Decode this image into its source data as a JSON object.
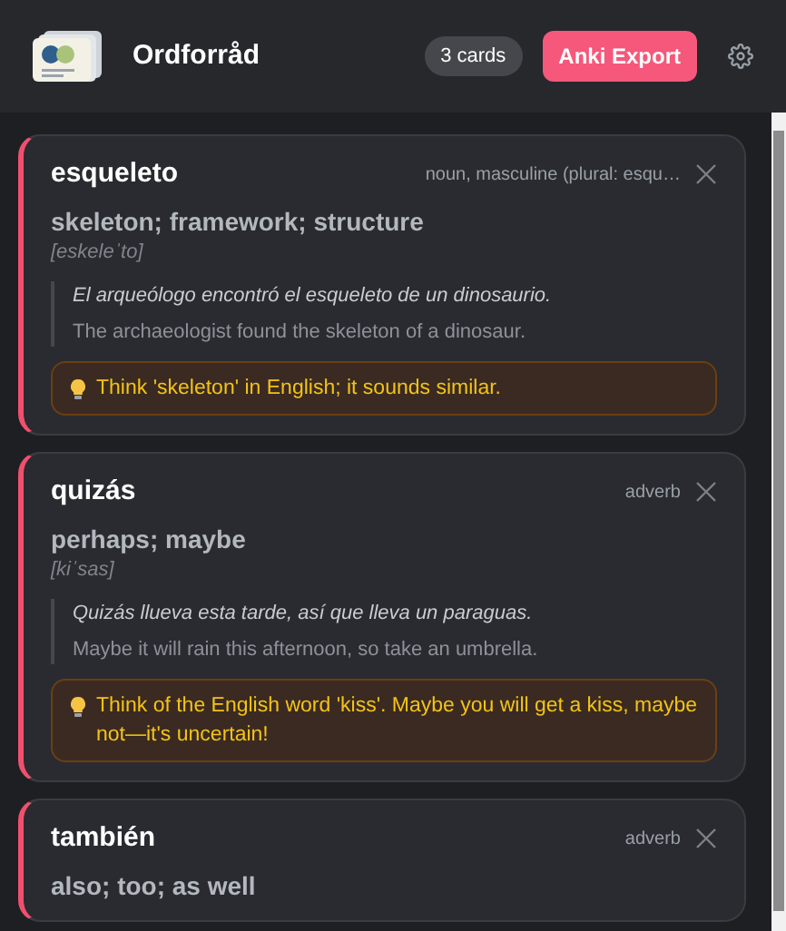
{
  "header": {
    "title": "Ordforråd",
    "count_badge": "3 cards",
    "export_button": "Anki Export"
  },
  "cards": [
    {
      "word": "esqueleto",
      "part_of_speech": "noun, masculine (plural: esqu…",
      "translation": "skeleton; framework; structure",
      "pronunciation": "[eskeleˈto]",
      "example": "El arqueólogo encontró el esqueleto de un dinosaurio.",
      "example_translation": "The archaeologist found the skeleton of a dinosaur.",
      "tip": "Think 'skeleton' in English; it sounds similar."
    },
    {
      "word": "quizás",
      "part_of_speech": "adverb",
      "translation": "perhaps; maybe",
      "pronunciation": "[kiˈsas]",
      "example": "Quizás llueva esta tarde, así que lleva un paraguas.",
      "example_translation": "Maybe it will rain this afternoon, so take an umbrella.",
      "tip": "Think of the English word 'kiss'. Maybe you will get a kiss, maybe not—it's uncertain!"
    },
    {
      "word": "también",
      "part_of_speech": "adverb",
      "translation": "also; too; as well"
    }
  ]
}
